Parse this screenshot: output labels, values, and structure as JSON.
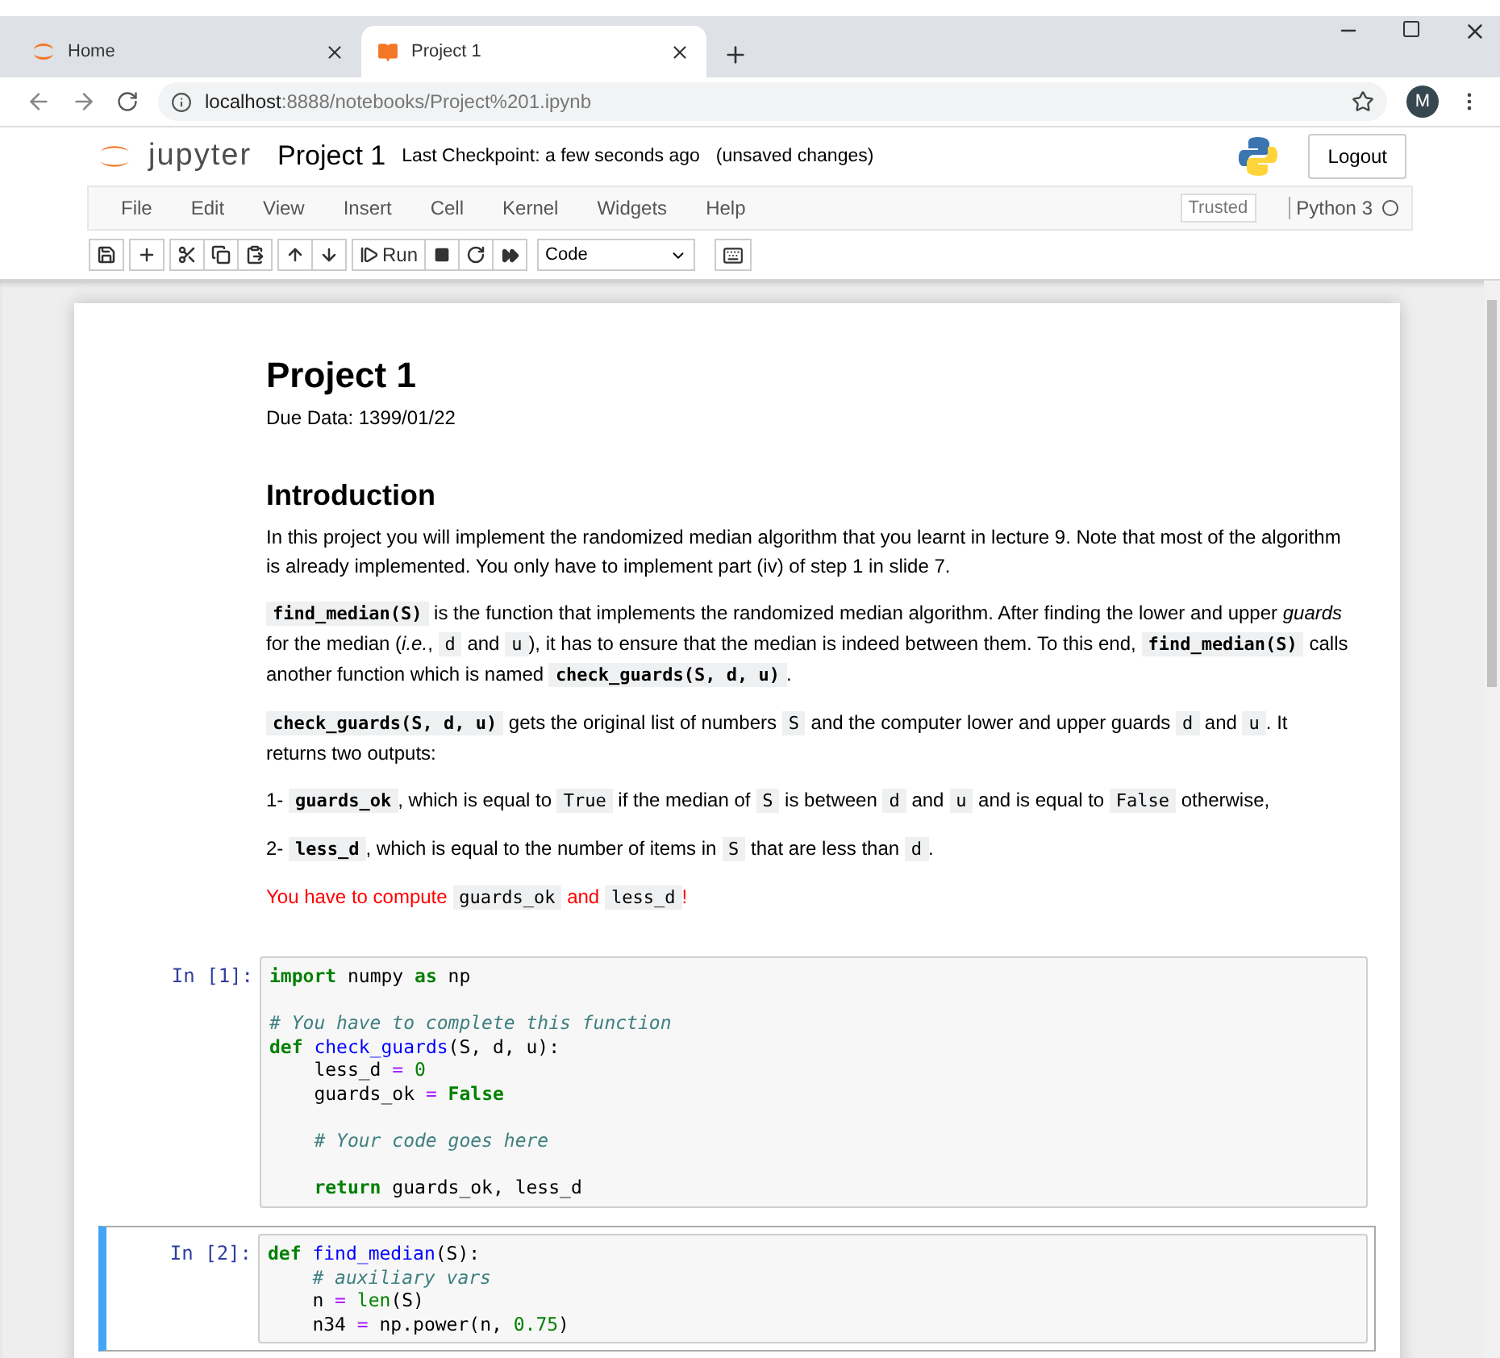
{
  "browser": {
    "tabs": [
      {
        "label": "Home",
        "kind": "home",
        "selected": false
      },
      {
        "label": "Project 1",
        "kind": "notebook",
        "selected": true
      }
    ],
    "url": {
      "host": "localhost",
      "path": ":8888/notebooks/Project%201.ipynb"
    },
    "profile": "M"
  },
  "header": {
    "logo": "jupyter",
    "title": "Project 1",
    "checkpoint": "Last Checkpoint: a few seconds ago",
    "status": "(unsaved changes)",
    "logout": "Logout"
  },
  "menu": [
    "File",
    "Edit",
    "View",
    "Insert",
    "Cell",
    "Kernel",
    "Widgets",
    "Help"
  ],
  "trusted": "Trusted",
  "kernel": {
    "name": "Python 3",
    "busy": false
  },
  "toolbar": {
    "run": "Run",
    "cell_type": "Code"
  },
  "cells": [
    {
      "kind": "markdown",
      "selected": false,
      "blocks": [
        {
          "kind": "h1",
          "text": "Project 1"
        },
        {
          "kind": "p",
          "parts": [
            {
              "kind": "text",
              "text": "Due Data: 1399/01/22"
            }
          ]
        },
        {
          "kind": "h2",
          "text": "Introduction"
        },
        {
          "kind": "p",
          "parts": [
            {
              "kind": "text",
              "text": "In this project you will implement the randomized median algorithm that you learnt in lecture 9. Note that most of the algorithm is already implemented. You only have to implement part (iv) of step 1 in slide 7."
            }
          ]
        },
        {
          "kind": "p",
          "parts": [
            {
              "kind": "strong_code",
              "text": "find_median(S)"
            },
            {
              "kind": "text",
              "text": " is the function that implements the randomized median algorithm. After finding the lower and upper *guards* for the median (*i.e.*, "
            },
            {
              "kind": "code",
              "text": "d"
            },
            {
              "kind": "text",
              "text": " and "
            },
            {
              "kind": "code",
              "text": "u"
            },
            {
              "kind": "text",
              "text": "), it has to ensure that the median is indeed between them. To this end, "
            },
            {
              "kind": "strong_code",
              "text": "find_median(S)"
            },
            {
              "kind": "text",
              "text": " calls another function which is named "
            },
            {
              "kind": "strong_code",
              "text": "check_guards(S, d, u)"
            },
            {
              "kind": "text",
              "text": "."
            }
          ]
        },
        {
          "kind": "p",
          "parts": [
            {
              "kind": "strong_code",
              "text": "check_guards(S, d, u)"
            },
            {
              "kind": "text",
              "text": " gets the original list of numbers "
            },
            {
              "kind": "code",
              "text": "S"
            },
            {
              "kind": "text",
              "text": " and the computer lower and upper guards "
            },
            {
              "kind": "code",
              "text": "d"
            },
            {
              "kind": "text",
              "text": " and "
            },
            {
              "kind": "code",
              "text": "u"
            },
            {
              "kind": "text",
              "text": ". It returns two outputs:"
            }
          ]
        },
        {
          "kind": "p",
          "parts": [
            {
              "kind": "text",
              "text": "1- "
            },
            {
              "kind": "strong_code",
              "text": "guards_ok"
            },
            {
              "kind": "text",
              "text": ", which is equal to "
            },
            {
              "kind": "code",
              "text": "True"
            },
            {
              "kind": "text",
              "text": " if the median of "
            },
            {
              "kind": "code",
              "text": "S"
            },
            {
              "kind": "text",
              "text": " is between "
            },
            {
              "kind": "code",
              "text": "d"
            },
            {
              "kind": "text",
              "text": " and "
            },
            {
              "kind": "code",
              "text": "u"
            },
            {
              "kind": "text",
              "text": " and is equal to "
            },
            {
              "kind": "code",
              "text": "False"
            },
            {
              "kind": "text",
              "text": " otherwise,"
            }
          ]
        },
        {
          "kind": "p",
          "parts": [
            {
              "kind": "text",
              "text": "2- "
            },
            {
              "kind": "strong_code",
              "text": "less_d"
            },
            {
              "kind": "text",
              "text": ", which is equal to the number of items in "
            },
            {
              "kind": "code",
              "text": "S"
            },
            {
              "kind": "text",
              "text": " that are less than "
            },
            {
              "kind": "code",
              "text": "d"
            },
            {
              "kind": "text",
              "text": "."
            }
          ]
        },
        {
          "kind": "alert",
          "parts": [
            {
              "kind": "text",
              "text": "You have to compute "
            },
            {
              "kind": "code",
              "text": "guards_ok"
            },
            {
              "kind": "text",
              "text": " and "
            },
            {
              "kind": "code",
              "text": "less_d"
            },
            {
              "kind": "text",
              "text": "!"
            }
          ]
        }
      ]
    },
    {
      "kind": "code",
      "selected": false,
      "prompt": "In [1]:",
      "lines": [
        {
          "gap_before": false,
          "tokens": [
            {
              "kind": "kw",
              "text": "import"
            },
            {
              "kind": "plain",
              "text": " numpy "
            },
            {
              "kind": "kw",
              "text": "as"
            },
            {
              "kind": "plain",
              "text": " np"
            }
          ]
        },
        {
          "gap_before": true,
          "tokens": [
            {
              "kind": "comment",
              "text": "# You have to complete this function"
            }
          ]
        },
        {
          "gap_before": false,
          "tokens": [
            {
              "kind": "kw",
              "text": "def "
            },
            {
              "kind": "func",
              "text": "check_guards"
            },
            {
              "kind": "plain",
              "text": "(S, d, u):"
            }
          ]
        },
        {
          "gap_before": false,
          "tokens": [
            {
              "kind": "plain",
              "text": "    less_d "
            },
            {
              "kind": "op",
              "text": "= "
            },
            {
              "kind": "num",
              "text": "0"
            }
          ]
        },
        {
          "gap_before": false,
          "tokens": [
            {
              "kind": "plain",
              "text": "    guards_ok "
            },
            {
              "kind": "op",
              "text": "= "
            },
            {
              "kind": "kw",
              "text": "False"
            }
          ]
        },
        {
          "gap_before": true,
          "tokens": [
            {
              "kind": "comment",
              "text": "    # Your code goes here"
            }
          ]
        },
        {
          "gap_before": true,
          "tokens": [
            {
              "kind": "kw",
              "text": "    return"
            },
            {
              "kind": "plain",
              "text": " guards_ok, less_d"
            }
          ]
        }
      ]
    },
    {
      "kind": "code",
      "selected": true,
      "prompt": "In [2]:",
      "lines": [
        {
          "gap_before": false,
          "tokens": [
            {
              "kind": "kw",
              "text": "def "
            },
            {
              "kind": "func",
              "text": "find_median"
            },
            {
              "kind": "plain",
              "text": "(S):"
            }
          ]
        },
        {
          "gap_before": false,
          "tokens": [
            {
              "kind": "comment",
              "text": "    # auxiliary vars"
            }
          ]
        },
        {
          "gap_before": false,
          "tokens": [
            {
              "kind": "plain",
              "text": "    n "
            },
            {
              "kind": "op",
              "text": "= "
            },
            {
              "kind": "builtin",
              "text": "len"
            },
            {
              "kind": "plain",
              "text": "(S)"
            }
          ]
        },
        {
          "gap_before": false,
          "tokens": [
            {
              "kind": "plain",
              "text": "    n34 "
            },
            {
              "kind": "op",
              "text": "="
            },
            {
              "kind": "plain",
              "text": " np.power(n, "
            },
            {
              "kind": "num",
              "text": "0.75"
            },
            {
              "kind": "plain",
              "text": ")"
            }
          ]
        }
      ]
    }
  ]
}
